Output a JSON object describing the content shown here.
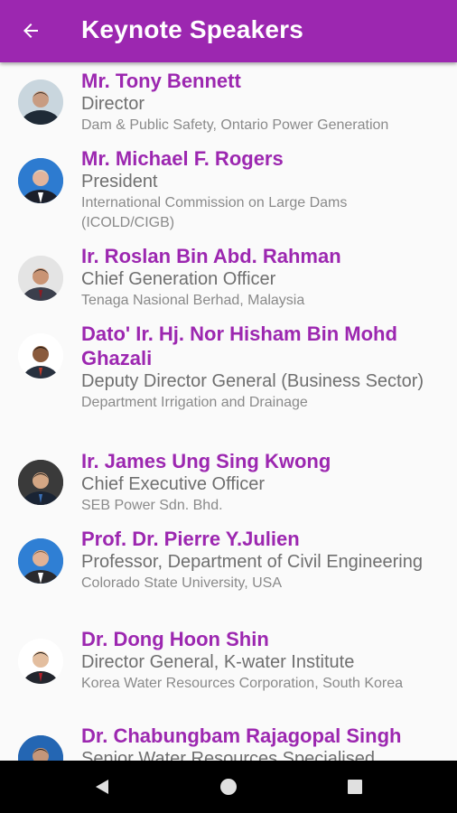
{
  "app_bar": {
    "title": "Keynote Speakers",
    "back_icon": "arrow-back-icon",
    "color": "#9c27b0"
  },
  "speakers": [
    {
      "name": "Mr. Tony Bennett",
      "title": "Director",
      "organization": "Dam & Public Safety, Ontario Power Generation"
    },
    {
      "name": "Mr. Michael F. Rogers",
      "title": "President",
      "organization": "International Commission on Large Dams (ICOLD/CIGB)"
    },
    {
      "name": "Ir. Roslan Bin Abd. Rahman",
      "title": "Chief Generation Officer",
      "organization": "Tenaga Nasional Berhad, Malaysia"
    },
    {
      "name": "Dato' Ir. Hj. Nor Hisham Bin Mohd Ghazali",
      "title": "Deputy Director General (Business Sector)",
      "organization": "Department Irrigation and Drainage"
    },
    {
      "name": "Ir. James Ung Sing Kwong",
      "title": "Chief Executive Officer",
      "organization": "SEB Power Sdn. Bhd."
    },
    {
      "name": "Prof. Dr. Pierre Y.Julien",
      "title": "Professor, Department of Civil Engineering",
      "organization": "Colorado State University, USA"
    },
    {
      "name": "Dr. Dong Hoon Shin",
      "title": "Director General, K-water Institute",
      "organization": "Korea Water Resources Corporation, South Korea"
    },
    {
      "name": "Dr. Chabungbam Rajagopal Singh",
      "title": "Senior Water Resources Specialised",
      "organization": ""
    }
  ],
  "nav_bar": {
    "back_icon": "nav-back-triangle-icon",
    "home_icon": "nav-home-circle-icon",
    "recents_icon": "nav-recents-square-icon"
  }
}
